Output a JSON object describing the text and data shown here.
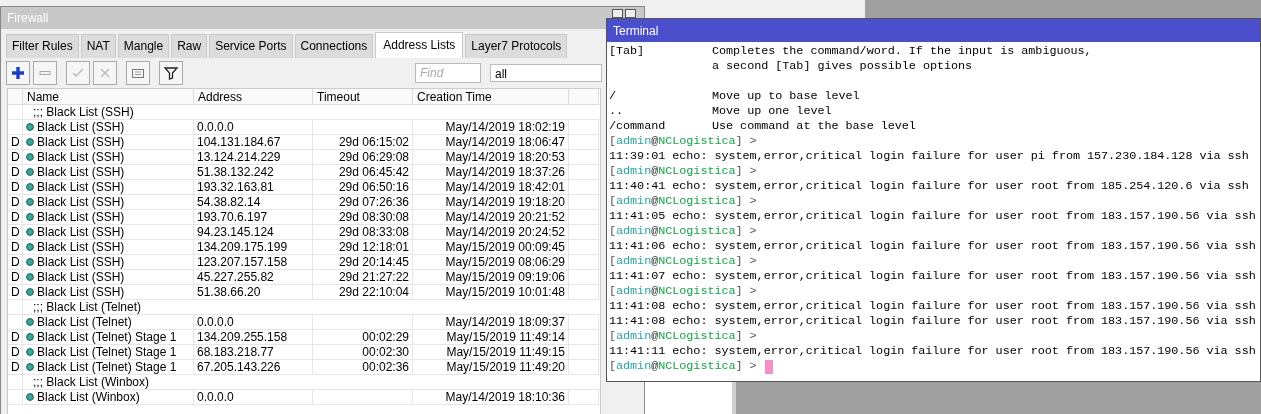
{
  "firewall": {
    "title": "Firewall",
    "tabs": [
      {
        "label": "Filter Rules",
        "selected": false
      },
      {
        "label": "NAT",
        "selected": false
      },
      {
        "label": "Mangle",
        "selected": false
      },
      {
        "label": "Raw",
        "selected": false
      },
      {
        "label": "Service Ports",
        "selected": false
      },
      {
        "label": "Connections",
        "selected": false
      },
      {
        "label": "Address Lists",
        "selected": true
      },
      {
        "label": "Layer7 Protocols",
        "selected": false
      }
    ],
    "toolbar": {
      "find": {
        "placeholder": "Find"
      },
      "filter_value": "all"
    },
    "table": {
      "columns": [
        "Name",
        "Address",
        "Timeout",
        "Creation Time"
      ],
      "rows": [
        {
          "kind": "group",
          "comment": ";;; Black List (SSH)"
        },
        {
          "kind": "entry",
          "name": "Black List (SSH)",
          "address": "0.0.0.0",
          "created": "May/14/2019 18:02:19"
        },
        {
          "kind": "entry",
          "flag": "D",
          "name": "Black List (SSH)",
          "address": "104.131.184.67",
          "timeout": "29d 06:15:02",
          "created": "May/14/2019 18:06:47"
        },
        {
          "kind": "entry",
          "flag": "D",
          "name": "Black List (SSH)",
          "address": "13.124.214.229",
          "timeout": "29d 06:29:08",
          "created": "May/14/2019 18:20:53"
        },
        {
          "kind": "entry",
          "flag": "D",
          "name": "Black List (SSH)",
          "address": "51.38.132.242",
          "timeout": "29d 06:45:42",
          "created": "May/14/2019 18:37:26"
        },
        {
          "kind": "entry",
          "flag": "D",
          "name": "Black List (SSH)",
          "address": "193.32.163.81",
          "timeout": "29d 06:50:16",
          "created": "May/14/2019 18:42:01"
        },
        {
          "kind": "entry",
          "flag": "D",
          "name": "Black List (SSH)",
          "address": "54.38.82.14",
          "timeout": "29d 07:26:36",
          "created": "May/14/2019 19:18:20"
        },
        {
          "kind": "entry",
          "flag": "D",
          "name": "Black List (SSH)",
          "address": "193.70.6.197",
          "timeout": "29d 08:30:08",
          "created": "May/14/2019 20:21:52"
        },
        {
          "kind": "entry",
          "flag": "D",
          "name": "Black List (SSH)",
          "address": "94.23.145.124",
          "timeout": "29d 08:33:08",
          "created": "May/14/2019 20:24:52"
        },
        {
          "kind": "entry",
          "flag": "D",
          "name": "Black List (SSH)",
          "address": "134.209.175.199",
          "timeout": "29d 12:18:01",
          "created": "May/15/2019 00:09:45"
        },
        {
          "kind": "entry",
          "flag": "D",
          "name": "Black List (SSH)",
          "address": "123.207.157.158",
          "timeout": "29d 20:14:45",
          "created": "May/15/2019 08:06:29"
        },
        {
          "kind": "entry",
          "flag": "D",
          "name": "Black List (SSH)",
          "address": "45.227.255.82",
          "timeout": "29d 21:27:22",
          "created": "May/15/2019 09:19:06"
        },
        {
          "kind": "entry",
          "flag": "D",
          "name": "Black List (SSH)",
          "address": "51.38.66.20",
          "timeout": "29d 22:10:04",
          "created": "May/15/2019 10:01:48"
        },
        {
          "kind": "group",
          "comment": ";;; Black List (Telnet)"
        },
        {
          "kind": "entry",
          "name": "Black List (Telnet)",
          "address": "0.0.0.0",
          "created": "May/14/2019 18:09:37"
        },
        {
          "kind": "entry",
          "flag": "D",
          "name": "Black List (Telnet) Stage 1",
          "address": "134.209.255.158",
          "timeout": "00:02:29",
          "created": "May/15/2019 11:49:14"
        },
        {
          "kind": "entry",
          "flag": "D",
          "name": "Black List (Telnet) Stage 1",
          "address": "68.183.218.77",
          "timeout": "00:02:30",
          "created": "May/15/2019 11:49:15"
        },
        {
          "kind": "entry",
          "flag": "D",
          "name": "Black List (Telnet) Stage 1",
          "address": "67.205.143.226",
          "timeout": "00:02:36",
          "created": "May/15/2019 11:49:20"
        },
        {
          "kind": "group",
          "comment": ";;; Black List (Winbox)"
        },
        {
          "kind": "entry",
          "name": "Black List (Winbox)",
          "address": "0.0.0.0",
          "created": "May/14/2019 18:10:36"
        }
      ]
    }
  },
  "terminal": {
    "title": "Terminal",
    "lines": [
      {
        "kind": "help",
        "key": "[Tab]",
        "text": "Completes the command/word. If the input is ambiguous,"
      },
      {
        "kind": "help_cont",
        "text": "a second [Tab] gives possible options"
      },
      {
        "kind": "blank"
      },
      {
        "kind": "help",
        "key": "/",
        "text": "Move up to base level"
      },
      {
        "kind": "help",
        "key": "..",
        "text": "Move up one level"
      },
      {
        "kind": "help",
        "key": "/command",
        "text": "Use command at the base level"
      },
      {
        "kind": "prompt",
        "open": "[",
        "user": "admin",
        "at": "@",
        "host": "NCLogistica",
        "close": "] >",
        "cursor": false
      },
      {
        "kind": "log",
        "text": "11:39:01 echo: system,error,critical login failure for user pi from 157.230.184.128 via ssh"
      },
      {
        "kind": "prompt",
        "open": "[",
        "user": "admin",
        "at": "@",
        "host": "NCLogistica",
        "close": "] >",
        "cursor": false
      },
      {
        "kind": "log",
        "text": "11:40:41 echo: system,error,critical login failure for user root from 185.254.120.6 via ssh"
      },
      {
        "kind": "prompt",
        "open": "[",
        "user": "admin",
        "at": "@",
        "host": "NCLogistica",
        "close": "] >",
        "cursor": false
      },
      {
        "kind": "log",
        "text": "11:41:05 echo: system,error,critical login failure for user root from 183.157.190.56 via ssh"
      },
      {
        "kind": "prompt",
        "open": "[",
        "user": "admin",
        "at": "@",
        "host": "NCLogistica",
        "close": "] >",
        "cursor": false
      },
      {
        "kind": "log",
        "text": "11:41:06 echo: system,error,critical login failure for user root from 183.157.190.56 via ssh"
      },
      {
        "kind": "prompt",
        "open": "[",
        "user": "admin",
        "at": "@",
        "host": "NCLogistica",
        "close": "] >",
        "cursor": false
      },
      {
        "kind": "log",
        "text": "11:41:07 echo: system,error,critical login failure for user root from 183.157.190.56 via ssh"
      },
      {
        "kind": "prompt",
        "open": "[",
        "user": "admin",
        "at": "@",
        "host": "NCLogistica",
        "close": "] >",
        "cursor": false
      },
      {
        "kind": "log",
        "text": "11:41:08 echo: system,error,critical login failure for user root from 183.157.190.56 via ssh"
      },
      {
        "kind": "log",
        "text": "11:41:08 echo: system,error,critical login failure for user root from 183.157.190.56 via ssh"
      },
      {
        "kind": "prompt",
        "open": "[",
        "user": "admin",
        "at": "@",
        "host": "NCLogistica",
        "close": "] >",
        "cursor": false
      },
      {
        "kind": "log",
        "text": "11:41:11 echo: system,error,critical login failure for user root from 183.157.190.56 via ssh"
      },
      {
        "kind": "prompt",
        "open": "[",
        "user": "admin",
        "at": "@",
        "host": "NCLogistica",
        "close": "] >",
        "cursor": true
      }
    ]
  }
}
